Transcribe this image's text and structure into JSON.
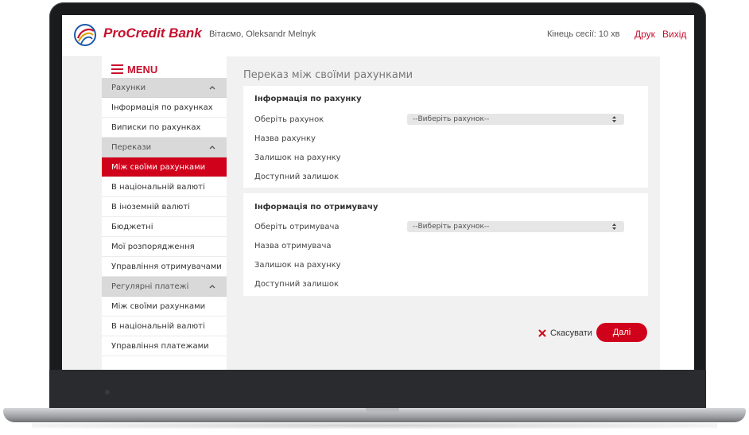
{
  "header": {
    "brand": "ProCredit Bank",
    "greeting": "Вітаємо, Oleksandr Melnyk",
    "session": "Кінець сесії: 10 хв",
    "print": "Друк",
    "exit": "Вихід"
  },
  "sidebar": {
    "menu_label": "MENU",
    "items": [
      {
        "label": "Рахунки",
        "type": "group"
      },
      {
        "label": "Інформація по рахунках",
        "type": "item"
      },
      {
        "label": "Виписки по рахунках",
        "type": "item"
      },
      {
        "label": "Перекази",
        "type": "group"
      },
      {
        "label": "Між своїми рахунками",
        "type": "active"
      },
      {
        "label": "В національній валюті",
        "type": "item"
      },
      {
        "label": "В іноземній валюті",
        "type": "item"
      },
      {
        "label": "Бюджетні",
        "type": "item"
      },
      {
        "label": "Мої розпорядження",
        "type": "item"
      },
      {
        "label": "Управління отримувачами",
        "type": "item"
      },
      {
        "label": "Регулярні платежі",
        "type": "group"
      },
      {
        "label": "Між своїми рахунками",
        "type": "item"
      },
      {
        "label": "В національній валюті",
        "type": "item"
      },
      {
        "label": "Управління платежами",
        "type": "item"
      }
    ]
  },
  "main": {
    "title": "Переказ між своїми рахунками",
    "account_card": {
      "title": "Інформація по рахунку",
      "select_label": "Оберіть рахунок",
      "select_value": "--Виберіть рахунок--",
      "name_label": "Назва рахунку",
      "balance_label": "Залишок на рахунку",
      "available_label": "Доступний залишок"
    },
    "recipient_card": {
      "title": "Інформація по отримувачу",
      "select_label": "Оберіть отримувача",
      "select_value": "--Виберіть рахунок--",
      "name_label": "Назва отримувача",
      "balance_label": "Залишок на рахунку",
      "available_label": "Доступний залишок"
    },
    "cancel_label": "Скасувати",
    "next_label": "Далі"
  },
  "colors": {
    "brand_red": "#c8102e",
    "active_red": "#d0021b"
  }
}
